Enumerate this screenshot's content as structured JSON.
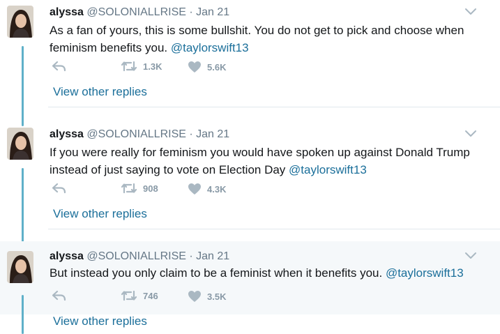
{
  "colors": {
    "thread_line": "#5fb0c9",
    "mention": "#1b6f9a",
    "muted": "#657786",
    "highlight_bg": "#f5f8fa"
  },
  "tweets": [
    {
      "name": "alyssa",
      "handle": "@SOLONIALLRISE",
      "dot": "·",
      "date": "Jan 21",
      "text_lines": [
        "As a fan of yours, this is some bullshit. You do not get to pick and choose when",
        "feminism benefits you. "
      ],
      "mention": "@taylorswift13",
      "retweets": "1.3K",
      "likes": "5.6K",
      "more_replies": "View other replies"
    },
    {
      "name": "alyssa",
      "handle": "@SOLONIALLRISE",
      "dot": "·",
      "date": "Jan 21",
      "text_lines": [
        "If you were really for feminism you would have spoken up against Donald Trump",
        "instead of just saying to vote on Election Day "
      ],
      "mention": "@taylorswift13",
      "retweets": "908",
      "likes": "4.3K",
      "more_replies": "View other replies"
    },
    {
      "name": "alyssa",
      "handle": "@SOLONIALLRISE",
      "dot": "·",
      "date": "Jan 21",
      "text_lines": [
        "But instead you only claim to be a feminist when it benefits you. "
      ],
      "mention": "@taylorswift13",
      "retweets": "746",
      "likes": "3.5K",
      "more_replies": "View other replies"
    }
  ],
  "icons": {
    "reply": "reply-icon",
    "retweet": "retweet-icon",
    "like": "heart-icon",
    "menu": "chevron-down-icon"
  }
}
